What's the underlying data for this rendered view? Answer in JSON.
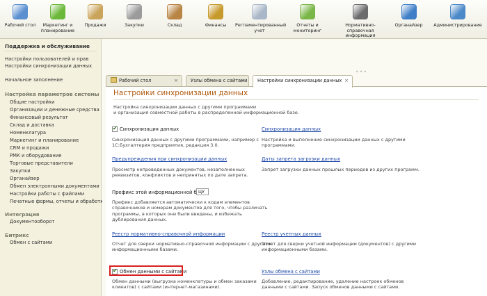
{
  "sections": [
    {
      "label": "Рабочий стол",
      "icon": "desktop-icon",
      "color": "#5b8fd0"
    },
    {
      "label": "Маркетинг и планирование",
      "icon": "marketing-icon",
      "color": "#6bb83a"
    },
    {
      "label": "Продажи",
      "icon": "sales-icon",
      "color": "#c9a45a"
    },
    {
      "label": "Закупки",
      "icon": "purchases-icon",
      "color": "#9b9b9b"
    },
    {
      "label": "Склад",
      "icon": "warehouse-icon",
      "color": "#b98545"
    },
    {
      "label": "Финансы",
      "icon": "finance-icon",
      "color": "#c79a2c"
    },
    {
      "label": "Регламентированный учет",
      "icon": "accounting-icon",
      "color": "#aab7c8"
    },
    {
      "label": "Отчеты и мониторинг",
      "icon": "reports-icon",
      "color": "#7ab648"
    },
    {
      "label": "Нормативно-справочная информация",
      "icon": "reference-icon",
      "color": "#6b6b6b"
    },
    {
      "label": "Органайзер",
      "icon": "organizer-icon",
      "color": "#3f7fc8"
    },
    {
      "label": "Администрирование",
      "icon": "admin-icon",
      "color": "#4b89c8"
    }
  ],
  "sidebar": {
    "support_title": "Поддержка и обслуживание",
    "support_links": [
      "Настройки пользователей и прав",
      "Настройки синхронизации данных"
    ],
    "initial_fill": "Начальное заполнение",
    "params_title": "Настройка параметров системы",
    "params_links": [
      "Общие настройки",
      "Организации и денежные средства",
      "Финансовый результат",
      "Склад и доставка",
      "Номенклатура",
      "Маркетинг и планирование",
      "CRM и продажи",
      "РМК и оборудование",
      "Торговые представители",
      "Закупки",
      "Органайзер",
      "Обмен электронными документами",
      "Настройки работы с файлами",
      "Печатные формы, отчеты и обработки"
    ],
    "integration_title": "Интеграция",
    "integration_links": [
      "Документооборот"
    ],
    "bitrix_title": "Битрикс",
    "bitrix_links": [
      "Обмен с сайтами"
    ]
  },
  "tabs": [
    {
      "label": "Рабочий стол",
      "close": "×"
    },
    {
      "label": "Узлы обмена с сайтами",
      "close": "×"
    },
    {
      "label": "Настройки синхронизации данных",
      "close": "×"
    }
  ],
  "panel": {
    "title": "Настройки синхронизации данных",
    "intro": "Настройка синхронизации данных с другими программами\nи организация совместной работы в распределенной информационной базе.",
    "sync_checkbox": "Синхронизация данных",
    "sync_checked": true,
    "sync_desc": "Синхронизация данных с другими программами, например с\n1С:Бухгалтерия предприятия, редакция 3.0.",
    "sync_link": "Синхронизация данных",
    "sync_link_desc": "Настройка и выполнение синхронизации данных с другими\nпрограммами.",
    "warnings_link": "Предупреждения при синхронизации данных",
    "warnings_desc": "Просмотр непроведенных документов, незаполненных\nреквизитов, конфликтов и непринятых по дате запрета.",
    "dates_link": "Даты запрета загрузки данных",
    "dates_desc": "Запрет загрузки данных прошлых периодов из других программ.",
    "prefix_label": "Префикс этой информационной базы:",
    "prefix_value": "ЦУ",
    "prefix_desc": "Префикс добавляется автоматически к кодам элементов\nсправочников и номерам документов для того, чтобы различать\nпрограммы, в которых они были введены, и избежать\nдублирования данных.",
    "reg_link": "Реестр нормативно-справочной информации",
    "reg_desc": "Отчет для сверки нормативно-справочной информации с другими\nинформационными базами.",
    "acc_link": "Реестр учетных данных",
    "acc_desc": "Отчет для сверки учетной информации (документов) с другими\nинформационными базами.",
    "exchange_checkbox": "Обмен данными с сайтами",
    "exchange_checked": true,
    "exchange_desc": "Обмен данными (выгрузка номенклатуры и обмен заказами\nклиентов) с сайтами (интернет-магазинами).",
    "nodes_link": "Узлы обмена с сайтами",
    "nodes_desc": "Добавление, редактирование, удаление настроек обменов\nданными с сайтами. Запуск обменов данными с сайтами."
  }
}
